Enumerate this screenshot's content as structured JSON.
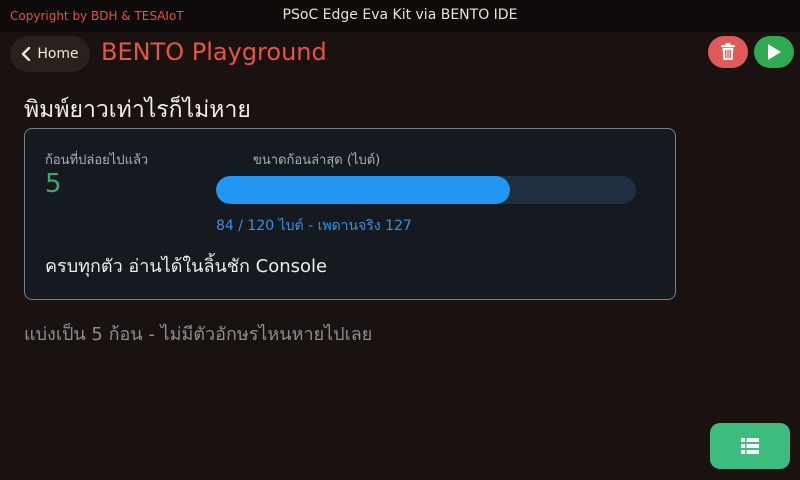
{
  "topbar": {
    "copyright": "Copyright by BDH & TESAIoT",
    "title": "PSoC Edge Eva Kit via BENTO IDE"
  },
  "header": {
    "home_label": "Home",
    "app_title": "BENTO Playground",
    "home_icon": "chevron-left-icon",
    "trash_icon": "trash-icon",
    "play_icon": "play-icon"
  },
  "main": {
    "heading": "พิมพ์ยาวเท่าไรก็ไม่หาย",
    "card": {
      "released_label": "ก้อนที่ปล่อยไปแล้ว",
      "released_value": "5",
      "size_label": "ขนาดก้อนล่าสุด (ไบต์)",
      "progress_fraction": 0.7,
      "progress_caption": "84 / 120 ไบต์ - เพดานจริง 127",
      "status_text": "ครบทุกตัว อ่านได้ในลิ้นชัก Console"
    },
    "footnote": "แบ่งเป็น 5 ก้อน - ไม่มีตัวอักษรไหนหายไปเลย"
  },
  "fab": {
    "icon": "list-icon"
  },
  "colors": {
    "accent_title": "#e8553f",
    "progress": "#2196f3",
    "value_green": "#3fa86a",
    "trash_bg": "#e05a5a",
    "play_bg": "#2eaa52",
    "fab_bg": "#3dbd7d"
  }
}
